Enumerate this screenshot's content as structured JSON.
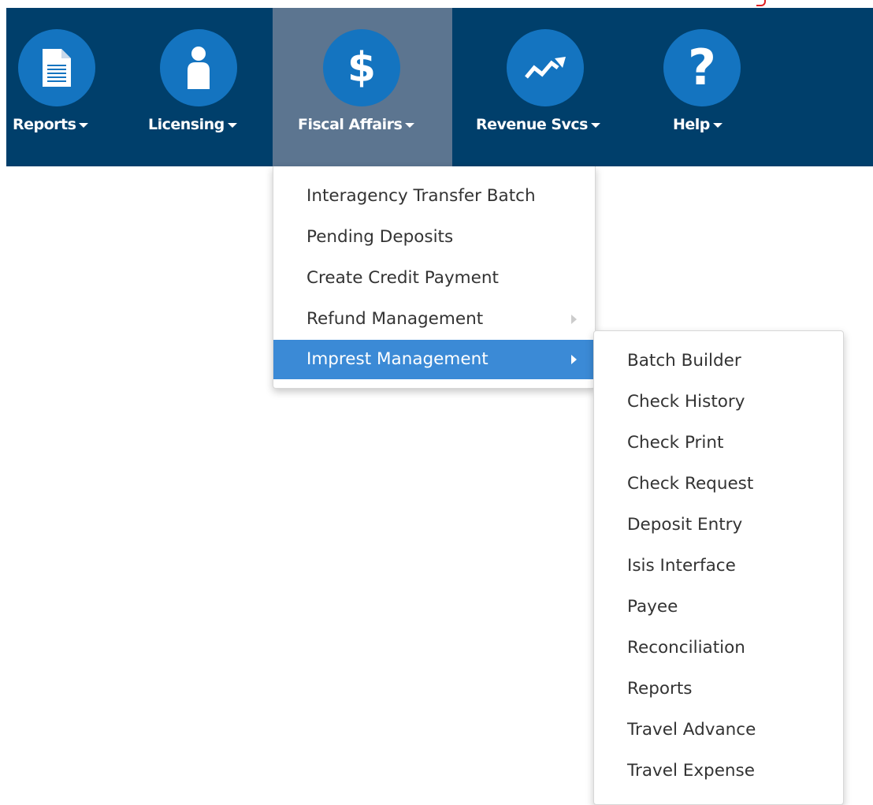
{
  "nav": {
    "items": [
      {
        "label": "Reports",
        "icon": "document-icon"
      },
      {
        "label": "Licensing",
        "icon": "person-icon"
      },
      {
        "label": "Fiscal Affairs",
        "icon": "dollar-icon",
        "active": true
      },
      {
        "label": "Revenue Svcs",
        "icon": "trend-up-icon"
      },
      {
        "label": "Help",
        "icon": "help-icon"
      }
    ]
  },
  "fiscal_menu": {
    "items": [
      {
        "label": "Interagency Transfer Batch"
      },
      {
        "label": "Pending Deposits"
      },
      {
        "label": "Create Credit Payment"
      },
      {
        "label": "Refund Management",
        "has_submenu": true
      },
      {
        "label": "Imprest Management",
        "has_submenu": true,
        "active": true
      }
    ]
  },
  "imprest_submenu": {
    "items": [
      "Batch Builder",
      "Check History",
      "Check Print",
      "Check Request",
      "Deposit Entry",
      "Isis Interface",
      "Payee",
      "Reconciliation",
      "Reports",
      "Travel Advance",
      "Travel Expense"
    ]
  },
  "colors": {
    "nav_background": "#003f6b",
    "nav_active": "#5c7590",
    "icon_circle": "#1474c0",
    "menu_highlight": "#3b8ad6"
  }
}
